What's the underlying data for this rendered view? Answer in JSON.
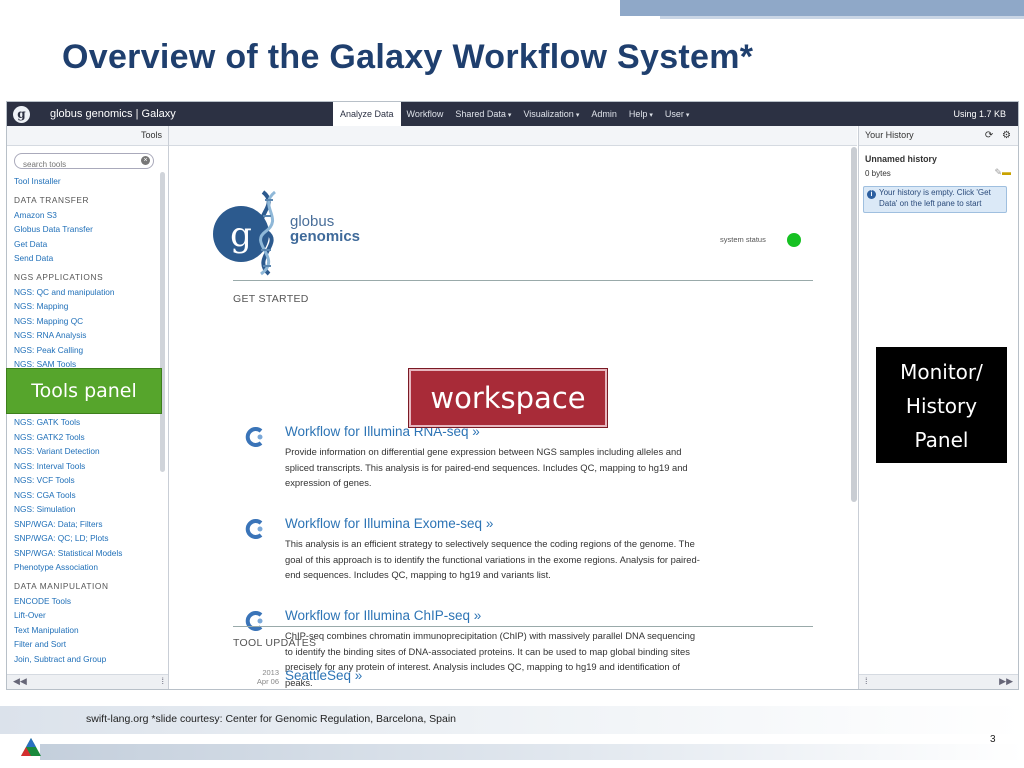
{
  "slide": {
    "title": "Overview of the Galaxy Workflow System*",
    "footer": "swift-lang.org  *slide courtesy: Center for Genomic Regulation, Barcelona, Spain",
    "page_number": "3"
  },
  "masthead": {
    "logo_letter": "g",
    "brand": "globus genomics | Galaxy",
    "nav": [
      {
        "label": "Analyze Data",
        "active": true,
        "dropdown": false
      },
      {
        "label": "Workflow",
        "active": false,
        "dropdown": false
      },
      {
        "label": "Shared Data",
        "active": false,
        "dropdown": true
      },
      {
        "label": "Visualization",
        "active": false,
        "dropdown": true
      },
      {
        "label": "Admin",
        "active": false,
        "dropdown": false
      },
      {
        "label": "Help",
        "active": false,
        "dropdown": true
      },
      {
        "label": "User",
        "active": false,
        "dropdown": true
      }
    ],
    "usage": "Using 1.7 KB"
  },
  "tools_panel": {
    "header": "Tools",
    "search_placeholder": "search tools",
    "items": [
      {
        "type": "link",
        "label": "Tool Installer"
      },
      {
        "type": "section",
        "label": "DATA TRANSFER"
      },
      {
        "type": "link",
        "label": "Amazon S3"
      },
      {
        "type": "link",
        "label": "Globus Data Transfer"
      },
      {
        "type": "link",
        "label": "Get Data"
      },
      {
        "type": "link",
        "label": "Send Data"
      },
      {
        "type": "section",
        "label": "NGS APPLICATIONS"
      },
      {
        "type": "link",
        "label": "NGS: QC and manipulation"
      },
      {
        "type": "link",
        "label": "NGS: Mapping"
      },
      {
        "type": "link",
        "label": "NGS: Mapping QC"
      },
      {
        "type": "link",
        "label": "NGS: RNA Analysis"
      },
      {
        "type": "link",
        "label": "NGS: Peak Calling"
      },
      {
        "type": "link",
        "label": "NGS: SAM Tools"
      },
      {
        "type": "link",
        "label": ""
      },
      {
        "type": "link",
        "label": ""
      },
      {
        "type": "link",
        "label": ""
      },
      {
        "type": "link",
        "label": "NGS: GATK Tools"
      },
      {
        "type": "link",
        "label": "NGS: GATK2 Tools"
      },
      {
        "type": "link",
        "label": "NGS: Variant Detection"
      },
      {
        "type": "link",
        "label": "NGS: Interval Tools"
      },
      {
        "type": "link",
        "label": "NGS: VCF Tools"
      },
      {
        "type": "link",
        "label": "NGS: CGA Tools"
      },
      {
        "type": "link",
        "label": "NGS: Simulation"
      },
      {
        "type": "link",
        "label": "SNP/WGA: Data; Filters"
      },
      {
        "type": "link",
        "label": "SNP/WGA: QC; LD; Plots"
      },
      {
        "type": "link",
        "label": "SNP/WGA: Statistical Models"
      },
      {
        "type": "link",
        "label": "Phenotype Association"
      },
      {
        "type": "section",
        "label": "DATA MANIPULATION"
      },
      {
        "type": "link",
        "label": "ENCODE Tools"
      },
      {
        "type": "link",
        "label": "Lift-Over"
      },
      {
        "type": "link",
        "label": "Text Manipulation"
      },
      {
        "type": "link",
        "label": "Filter and Sort"
      },
      {
        "type": "link",
        "label": "Join, Subtract and Group"
      }
    ],
    "collapse_glyph": "◀◀",
    "drag_glyph": "⁞"
  },
  "workspace": {
    "logo_line1": "globus",
    "logo_line2": "genomics",
    "system_status": "system status",
    "status_color": "#16c122",
    "get_started": "GET STARTED",
    "workflows": [
      {
        "title": "Workflow for Illumina RNA-seq »",
        "desc_lines": [
          "Provide information on differential gene expression between NGS samples including alleles and",
          "spliced transcripts. This analysis is for paired-end sequences. Includes QC, mapping to hg19 and",
          "expression of genes."
        ]
      },
      {
        "title": "Workflow for Illumina Exome-seq »",
        "desc_lines": [
          "This analysis is an efficient strategy to selectively sequence the coding regions of the genome. The",
          "goal of this approach is to identify the functional variations in the exome regions. Analysis for paired-",
          "end sequences. Includes QC, mapping to hg19 and variants list."
        ]
      },
      {
        "title": "Workflow for Illumina ChIP-seq »",
        "desc_lines": [
          "ChIP-seq combines chromatin immunoprecipitation (ChIP) with massively parallel DNA sequencing",
          "to identify the binding sites of DNA-associated proteins. It can be used to map global binding sites",
          "precisely for any protein of interest. Analysis includes QC, mapping to hg19 and identification of",
          "peaks."
        ]
      }
    ],
    "tool_updates": "TOOL UPDATES",
    "update": {
      "year": "2013",
      "date": "Apr 06",
      "title": "SeattleSeq »"
    }
  },
  "history_panel": {
    "header": "Your History",
    "name": "Unnamed history",
    "size": "0 bytes",
    "empty_message": "Your history is empty. Click 'Get Data' on the left pane to start",
    "expand_glyph": "▶▶",
    "drag_glyph": "⁞"
  },
  "callouts": {
    "tools": "Tools panel",
    "workspace": "workspace",
    "history_lines": [
      "Monitor/",
      "History",
      "Panel"
    ]
  },
  "icons": [
    "search-clear-icon",
    "refresh-icon",
    "gear-icon",
    "pencil-icon",
    "folder-icon",
    "info-icon",
    "workflow-icon",
    "dna-helix-icon"
  ]
}
